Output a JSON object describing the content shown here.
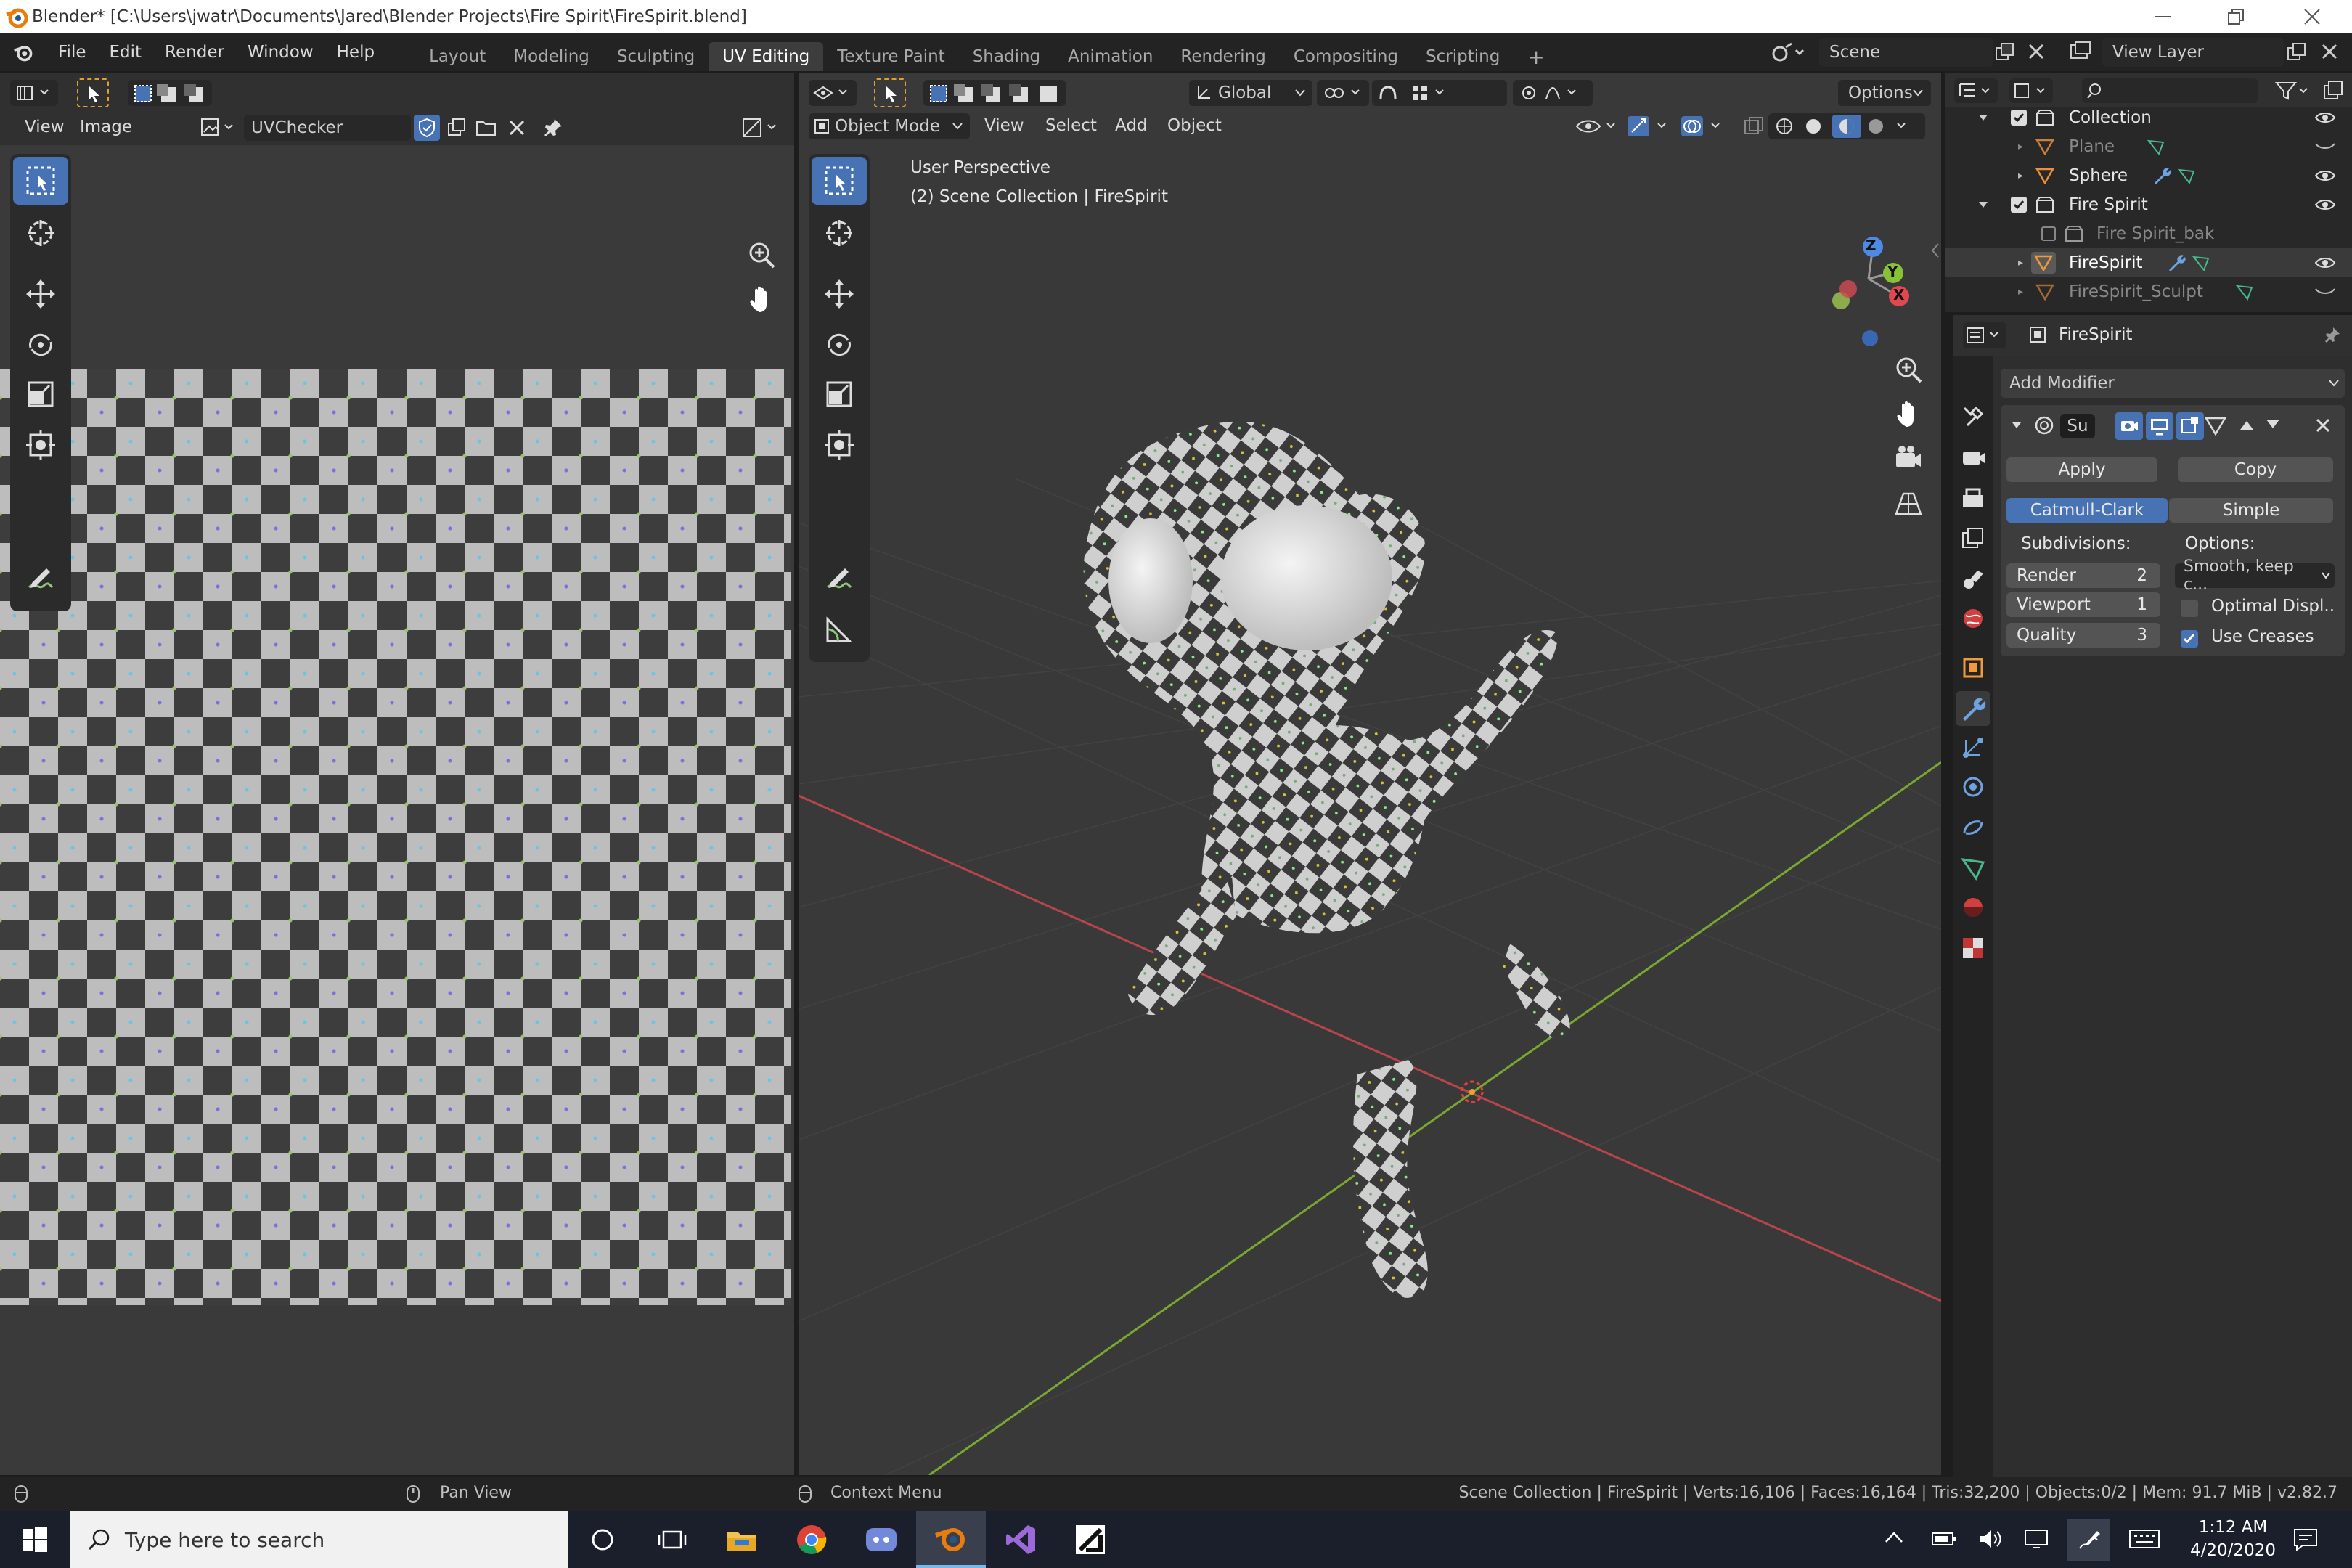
{
  "titlebar": {
    "title": "Blender* [C:\\Users\\jwatr\\Documents\\Jared\\Blender Projects\\Fire Spirit\\FireSpirit.blend]"
  },
  "menu": {
    "items": [
      "File",
      "Edit",
      "Render",
      "Window",
      "Help"
    ]
  },
  "workspaces": {
    "tabs": [
      "Layout",
      "Modeling",
      "Sculpting",
      "UV Editing",
      "Texture Paint",
      "Shading",
      "Animation",
      "Rendering",
      "Compositing",
      "Scripting"
    ],
    "add": "+",
    "active": "UV Editing"
  },
  "scene": {
    "name": "Scene",
    "view_layer": "View Layer"
  },
  "uv_editor": {
    "menu_view": "View",
    "menu_image": "Image",
    "image_name": "UVChecker"
  },
  "viewport": {
    "transform_orientation": "Global",
    "options": "Options",
    "mode": "Object Mode",
    "menus": [
      "View",
      "Select",
      "Add",
      "Object"
    ],
    "overlay_line1": "User Perspective",
    "overlay_line2": "(2) Scene Collection | FireSpirit",
    "gizmo": {
      "x": "X",
      "y": "Y",
      "z": "Z"
    }
  },
  "outliner": {
    "rows": [
      {
        "label": "Collection",
        "kind": "collection",
        "dim": false
      },
      {
        "label": "Plane",
        "kind": "mesh",
        "dim": true
      },
      {
        "label": "Sphere",
        "kind": "mesh",
        "dim": false
      },
      {
        "label": "Fire Spirit",
        "kind": "collection",
        "dim": false
      },
      {
        "label": "Fire Spirit_bak",
        "kind": "collection",
        "dim": true
      },
      {
        "label": "FireSpirit",
        "kind": "mesh",
        "dim": false
      },
      {
        "label": "FireSpirit_Sculpt",
        "kind": "mesh",
        "dim": true
      }
    ]
  },
  "properties": {
    "object_name": "FireSpirit",
    "add_modifier": "Add Modifier",
    "modifier_name": "Su",
    "apply": "Apply",
    "copy": "Copy",
    "catmull": "Catmull-Clark",
    "simple": "Simple",
    "subdivisions_label": "Subdivisions:",
    "options_label": "Options:",
    "render": {
      "label": "Render",
      "value": "2"
    },
    "viewport": {
      "label": "Viewport",
      "value": "1"
    },
    "quality": {
      "label": "Quality",
      "value": "3"
    },
    "uv_smooth": "Smooth, keep c...",
    "optimal_display": {
      "label": "Optimal Displ..",
      "checked": false
    },
    "use_creases": {
      "label": "Use Creases",
      "checked": true
    }
  },
  "status": {
    "pan": "Pan View",
    "context": "Context Menu",
    "stats": "Scene Collection | FireSpirit | Verts:16,106 | Faces:16,164 | Tris:32,200 | Objects:0/2 | Mem: 91.7 MiB | v2.82.7"
  },
  "taskbar": {
    "search_placeholder": "Type here to search",
    "time": "1:12 AM",
    "date": "4/20/2020"
  },
  "colors": {
    "accent": "#4772b3",
    "editor_bg": "#3a3a3a",
    "header_bg": "#303030",
    "x_axis": "#e0474e",
    "y_axis": "#87c234",
    "z_axis": "#4c8ae6"
  }
}
